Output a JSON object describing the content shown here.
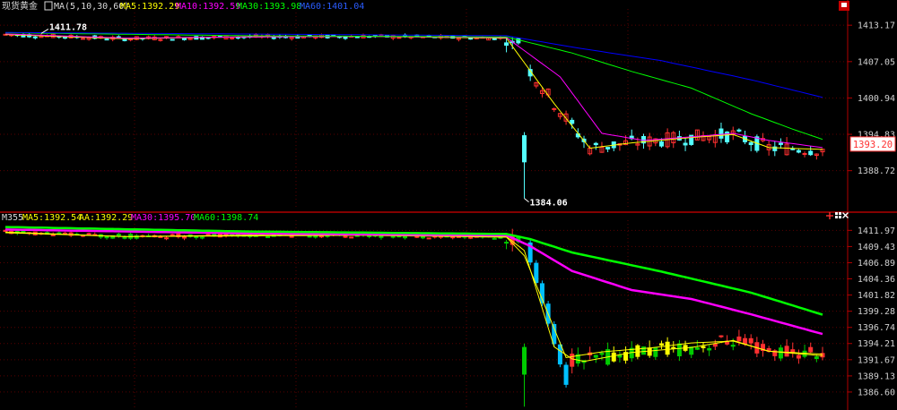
{
  "colors": {
    "background": "#000000",
    "grid": "#5a0000",
    "axis_text": "#d0d0d0",
    "divider": "#b00000",
    "ma5": "#ffff00",
    "ma10": "#ff00ff",
    "ma30": "#00ff00",
    "ma60": "#0000ff",
    "candle_up": "#ff3030",
    "candle_down": "#54ffff",
    "candle_up2": "#ffff00",
    "candle_down2": "#00c0ff",
    "candle_bottom_green": "#00cc00",
    "price_box_text": "#ff3030",
    "price_box_bg": "#ffffff"
  },
  "icons": {
    "corner_top": "corner-flag-icon",
    "crosshair": "crosshair-icon",
    "grid": "grid-icon",
    "close": "close-icon"
  },
  "chart_data": [
    {
      "type": "candlestick",
      "panel": "top",
      "header": {
        "instrument": "现货黄金",
        "indicator": "MA(5,10,30,60)",
        "ma5": "MA5:1392.29",
        "ma10": "MA10:1392.59",
        "ma30": "MA30:1393.98",
        "ma60": "MA60:1401.04"
      },
      "y_ticks": [
        "1413.17",
        "1407.05",
        "1400.94",
        "1394.83",
        "1388.72"
      ],
      "y_tick_values": [
        1413.17,
        1407.05,
        1400.94,
        1394.83,
        1388.72
      ],
      "ylim": [
        1382.5,
        1415.3
      ],
      "current_price": "1393.20",
      "current_price_value": 1393.2,
      "annotations": [
        {
          "text": "1411.78",
          "value": 1411.78,
          "bar": 6
        },
        {
          "text": "1384.06",
          "value": 1384.06,
          "bar": 87
        }
      ],
      "series_points": [
        {
          "name": "MA5",
          "points": [
            [
              0,
              1411.6
            ],
            [
              20,
              1410.9
            ],
            [
              40,
              1411.2
            ],
            [
              60,
              1411.3
            ],
            [
              84,
              1411.0
            ],
            [
              92,
              1400.0
            ],
            [
              98,
              1392.5
            ],
            [
              105,
              1393.4
            ],
            [
              115,
              1394.3
            ],
            [
              122,
              1394.8
            ],
            [
              128,
              1392.6
            ],
            [
              137,
              1392.3
            ]
          ]
        },
        {
          "name": "MA10",
          "points": [
            [
              0,
              1411.7
            ],
            [
              20,
              1411.0
            ],
            [
              40,
              1411.2
            ],
            [
              60,
              1411.3
            ],
            [
              84,
              1411.1
            ],
            [
              93,
              1404.5
            ],
            [
              100,
              1395.0
            ],
            [
              107,
              1393.8
            ],
            [
              115,
              1394.4
            ],
            [
              122,
              1395.0
            ],
            [
              128,
              1393.8
            ],
            [
              137,
              1392.6
            ]
          ]
        },
        {
          "name": "MA30",
          "points": [
            [
              0,
              1411.9
            ],
            [
              40,
              1411.4
            ],
            [
              84,
              1411.2
            ],
            [
              95,
              1408.5
            ],
            [
              105,
              1405.4
            ],
            [
              115,
              1402.6
            ],
            [
              125,
              1398.3
            ],
            [
              132,
              1395.7
            ],
            [
              137,
              1393.98
            ]
          ]
        },
        {
          "name": "MA60",
          "points": [
            [
              0,
              1411.95
            ],
            [
              84,
              1411.4
            ],
            [
              95,
              1409.5
            ],
            [
              110,
              1407.2
            ],
            [
              125,
              1404.0
            ],
            [
              137,
              1401.04
            ]
          ]
        }
      ]
    },
    {
      "type": "candlestick",
      "panel": "bottom",
      "header": {
        "label": "M355",
        "ma5": "MA5:1392.54",
        "aa": "AA:1392.29",
        "ma30": "MA30:1395.70",
        "ma60": "MA60:1398.74"
      },
      "y_ticks": [
        "1411.97",
        "1409.43",
        "1406.89",
        "1404.36",
        "1401.82",
        "1399.28",
        "1396.74",
        "1394.21",
        "1391.67",
        "1389.13",
        "1386.60"
      ],
      "y_tick_values": [
        1411.97,
        1409.43,
        1406.89,
        1404.36,
        1401.82,
        1399.28,
        1396.74,
        1394.21,
        1391.67,
        1389.13,
        1386.6
      ],
      "ylim": [
        1384.2,
        1413.0
      ],
      "series_points": [
        {
          "name": "MA5",
          "points": [
            [
              0,
              1411.7
            ],
            [
              20,
              1411.0
            ],
            [
              40,
              1411.2
            ],
            [
              60,
              1411.2
            ],
            [
              84,
              1411.0
            ],
            [
              87,
              1408.8
            ],
            [
              92,
              1393.7
            ],
            [
              95,
              1391.8
            ],
            [
              97,
              1391.4
            ],
            [
              105,
              1392.8
            ],
            [
              115,
              1393.6
            ],
            [
              122,
              1394.7
            ],
            [
              128,
              1393.0
            ],
            [
              137,
              1392.54
            ]
          ]
        },
        {
          "name": "AA",
          "points": [
            [
              0,
              1411.6
            ],
            [
              20,
              1411.0
            ],
            [
              40,
              1411.1
            ],
            [
              60,
              1411.2
            ],
            [
              84,
              1410.9
            ],
            [
              87,
              1408.0
            ],
            [
              94,
              1392.0
            ],
            [
              100,
              1392.9
            ],
            [
              108,
              1393.5
            ],
            [
              115,
              1394.3
            ],
            [
              122,
              1394.6
            ],
            [
              128,
              1393.0
            ],
            [
              137,
              1392.29
            ]
          ]
        },
        {
          "name": "MA30",
          "points": [
            [
              0,
              1412.1
            ],
            [
              40,
              1411.5
            ],
            [
              84,
              1411.2
            ],
            [
              88,
              1409.5
            ],
            [
              95,
              1405.6
            ],
            [
              105,
              1402.6
            ],
            [
              115,
              1401.2
            ],
            [
              125,
              1398.8
            ],
            [
              137,
              1395.7
            ]
          ]
        },
        {
          "name": "MA60",
          "points": [
            [
              0,
              1412.5
            ],
            [
              40,
              1411.8
            ],
            [
              84,
              1411.4
            ],
            [
              88,
              1410.6
            ],
            [
              95,
              1408.5
            ],
            [
              110,
              1405.5
            ],
            [
              125,
              1402.2
            ],
            [
              137,
              1398.74
            ]
          ]
        }
      ]
    }
  ]
}
